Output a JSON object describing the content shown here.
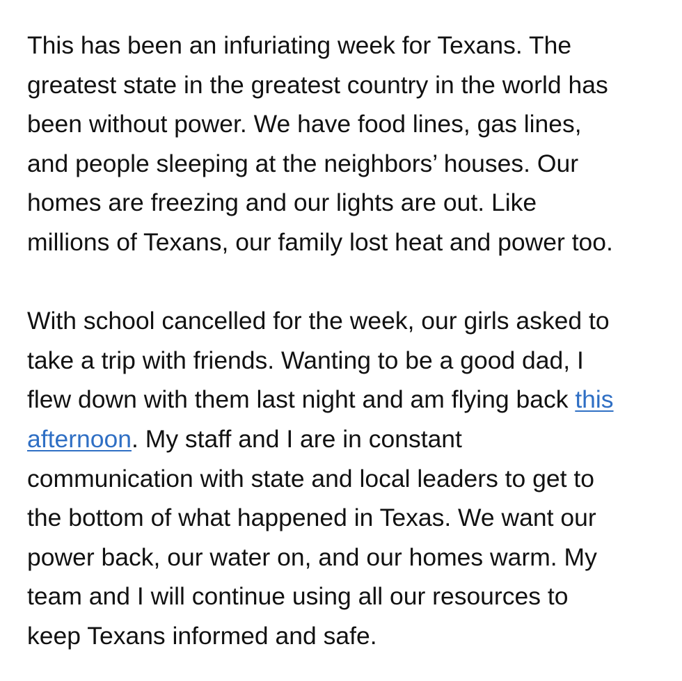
{
  "statement": {
    "paragraph_1": [
      "This has been an infuriating week for Texans. The",
      "greatest state in the greatest country in the world has",
      "been without power. We have food lines, gas lines,",
      "and people sleeping at the neighbors’ houses. Our",
      "homes are freezing and our lights are out. Like",
      "millions of Texans, our family lost heat and power too."
    ],
    "paragraph_2": {
      "line_1": "With school cancelled for the week, our girls asked to",
      "line_2": "take a trip with friends. Wanting to be a good dad, I",
      "line_3_text": "flew down with them last night and am flying back ",
      "link_part_1": "this",
      "link_part_2": "afternoon",
      "line_4_rest": ". My staff and I are in constant",
      "line_5": "communication with state and local leaders to get to",
      "line_6": "the bottom of what happened in Texas. We want our",
      "line_7": "power back, our water on, and our homes warm. My",
      "line_8": "team and I will continue using all our resources to",
      "line_9": "keep Texans informed and safe."
    }
  },
  "colors": {
    "text": "#111111",
    "link": "#2f6fc4",
    "background": "#ffffff"
  }
}
